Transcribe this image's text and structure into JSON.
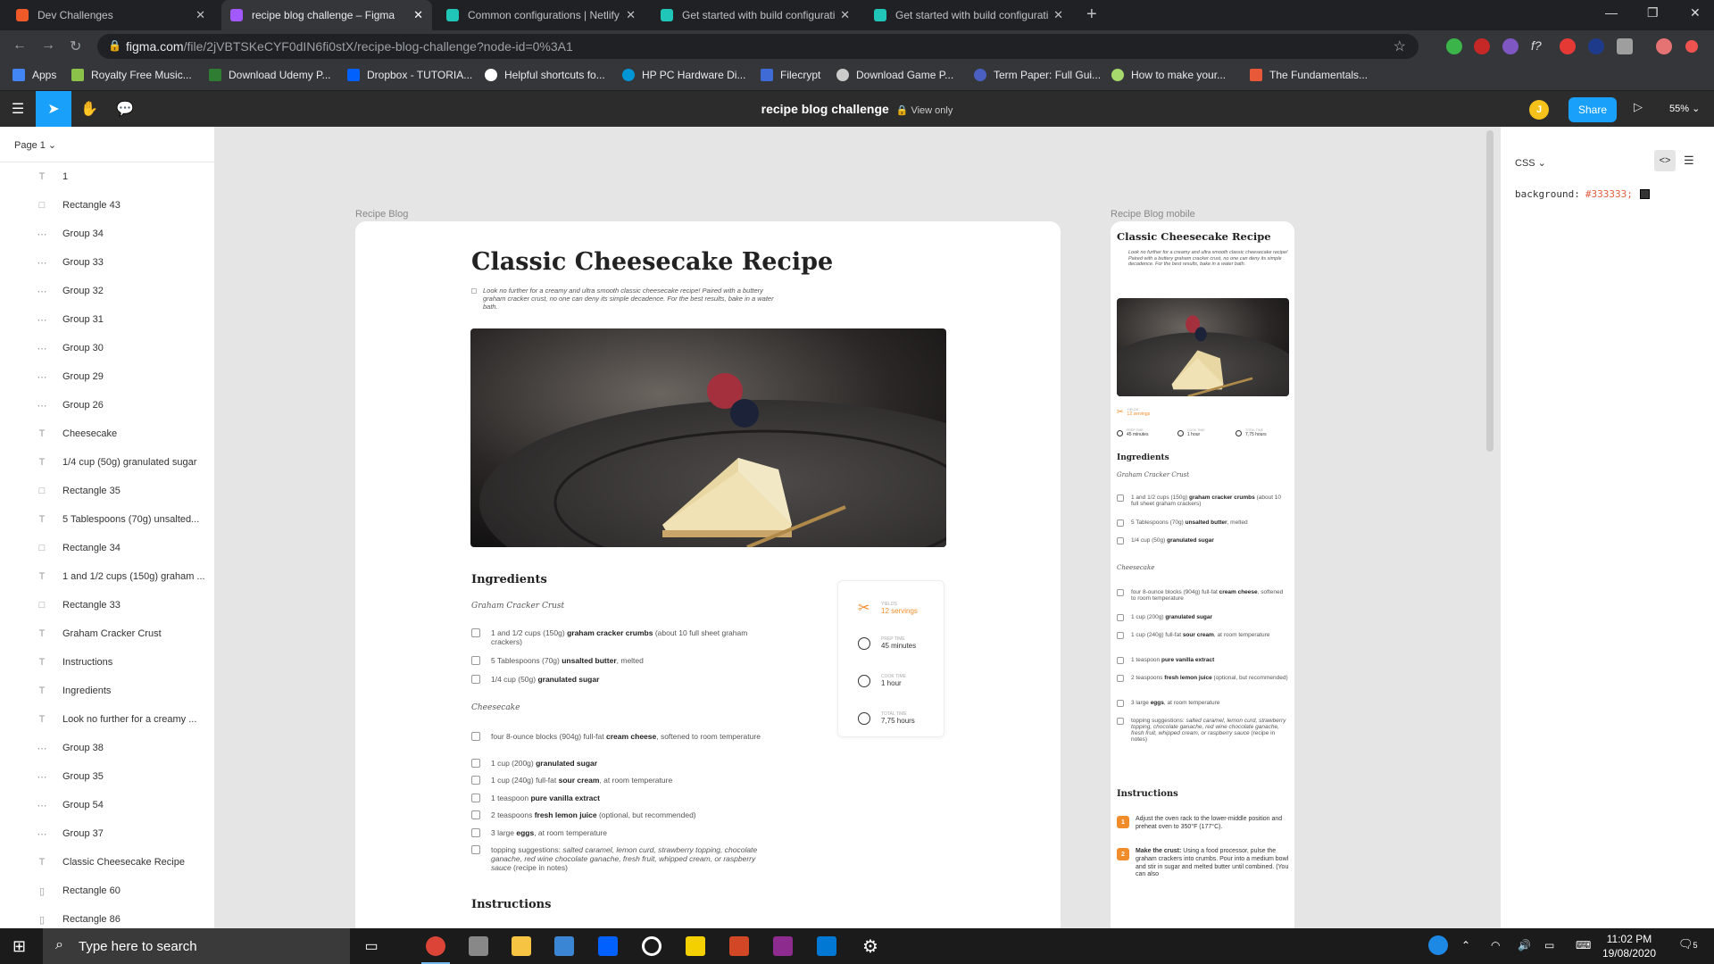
{
  "browser": {
    "tabs": [
      {
        "label": "Dev Challenges",
        "active": false,
        "color": "#f05a28"
      },
      {
        "label": "recipe blog challenge – Figma",
        "active": true,
        "color": "#a259ff"
      },
      {
        "label": "Common configurations | Netlify",
        "active": false,
        "color": "#20c6b7"
      },
      {
        "label": "Get started with build configurati",
        "active": false,
        "color": "#20c6b7"
      },
      {
        "label": "Get started with build configurati",
        "active": false,
        "color": "#20c6b7"
      }
    ],
    "new_tab": "+",
    "url_host": "figma.com",
    "url_path": "/file/2jVBTSKeCYF0dIN6fi0stX/recipe-blog-challenge?node-id=0%3A1",
    "bookmarks": [
      {
        "label": "Apps",
        "color": "#4285f4"
      },
      {
        "label": "Royalty Free Music...",
        "color": "#8bc34a"
      },
      {
        "label": "Download Udemy P...",
        "color": "#2e7d32"
      },
      {
        "label": "Dropbox - TUTORIA...",
        "color": "#0061ff"
      },
      {
        "label": "Helpful shortcuts fo...",
        "color": "#ffffff"
      },
      {
        "label": "HP PC Hardware Di...",
        "color": "#0096d6"
      },
      {
        "label": "Filecrypt",
        "color": "#3f6bd6"
      },
      {
        "label": "Download Game P...",
        "color": "#cccccc"
      },
      {
        "label": "Term Paper: Full Gui...",
        "color": "#4a5fc1"
      },
      {
        "label": "How to make your...",
        "color": "#a6d86e"
      },
      {
        "label": "The Fundamentals...",
        "color": "#e8593a"
      }
    ]
  },
  "figma": {
    "doc_title": "recipe blog challenge",
    "view_only": "View only",
    "avatar_initial": "J",
    "share_label": "Share",
    "zoom": "55%",
    "page_selector": "Page 1",
    "layers": [
      {
        "name": "1",
        "type": "text"
      },
      {
        "name": "Rectangle 43",
        "type": "rect"
      },
      {
        "name": "Group 34",
        "type": "group"
      },
      {
        "name": "Group 33",
        "type": "group"
      },
      {
        "name": "Group 32",
        "type": "group"
      },
      {
        "name": "Group 31",
        "type": "group"
      },
      {
        "name": "Group 30",
        "type": "group"
      },
      {
        "name": "Group 29",
        "type": "group"
      },
      {
        "name": "Group 26",
        "type": "group"
      },
      {
        "name": "Cheesecake",
        "type": "text"
      },
      {
        "name": "1/4 cup (50g) granulated sugar",
        "type": "text"
      },
      {
        "name": "Rectangle 35",
        "type": "rect"
      },
      {
        "name": "5 Tablespoons (70g) unsalted...",
        "type": "text"
      },
      {
        "name": "Rectangle 34",
        "type": "rect"
      },
      {
        "name": "1 and 1/2 cups (150g) graham ...",
        "type": "text"
      },
      {
        "name": "Rectangle 33",
        "type": "rect"
      },
      {
        "name": "Graham Cracker Crust",
        "type": "text"
      },
      {
        "name": "Instructions",
        "type": "text"
      },
      {
        "name": "Ingredients",
        "type": "text"
      },
      {
        "name": "Look no further for a creamy ...",
        "type": "text"
      },
      {
        "name": "Group 38",
        "type": "group"
      },
      {
        "name": "Group 35",
        "type": "group"
      },
      {
        "name": "Group 54",
        "type": "group"
      },
      {
        "name": "Group 37",
        "type": "group"
      },
      {
        "name": "Classic Cheesecake Recipe",
        "type": "text"
      },
      {
        "name": "Rectangle 60",
        "type": "line"
      },
      {
        "name": "Rectangle 86",
        "type": "line"
      }
    ],
    "inspect": {
      "tab": "CSS",
      "property": "background:",
      "value": "#333333;",
      "swatch": "#333333"
    }
  },
  "desktop_frame": {
    "label": "Recipe Blog",
    "title": "Classic Cheesecake Recipe",
    "description": "Look no further for a creamy and ultra smooth classic cheesecake recipe! Paired with a buttery graham cracker crust, no one can deny its simple decadence. For the best results, bake in a water bath.",
    "ingredients_heading": "Ingredients",
    "crust_heading": "Graham Cracker Crust",
    "crust_items": [
      {
        "pre": "1 and 1/2 cups (150g) ",
        "bold": "graham cracker crumbs",
        "post": " (about 10 full sheet graham crackers)"
      },
      {
        "pre": "5 Tablespoons (70g) ",
        "bold": "unsalted butter",
        "post": ", melted"
      },
      {
        "pre": "1/4 cup (50g) ",
        "bold": "granulated sugar",
        "post": ""
      }
    ],
    "cheesecake_heading": "Cheesecake",
    "cheesecake_items": [
      {
        "pre": "four 8-ounce blocks (904g) full-fat ",
        "bold": "cream cheese",
        "post": ", softened to room temperature"
      },
      {
        "pre": "1 cup (200g) ",
        "bold": "granulated sugar",
        "post": ""
      },
      {
        "pre": "1 cup (240g) full-fat ",
        "bold": "sour cream",
        "post": ", at room temperature"
      },
      {
        "pre": "1 teaspoon ",
        "bold": "pure vanilla extract",
        "post": ""
      },
      {
        "pre": "2 teaspoons ",
        "bold": "fresh lemon juice",
        "post": " (optional, but recommended)"
      },
      {
        "pre": "3 large ",
        "bold": "eggs",
        "post": ", at room temperature"
      }
    ],
    "toppings": {
      "pre": "topping suggestions: ",
      "ital": "salted caramel, lemon curd, strawberry topping, chocolate ganache, red wine chocolate ganache, fresh fruit, whipped cream, or raspberry sauce",
      "post": " (recipe in notes)"
    },
    "info": [
      {
        "label": "Yields",
        "value": "12 servings"
      },
      {
        "label": "Prep time",
        "value": "45 minutes"
      },
      {
        "label": "Cook time",
        "value": "1 hour"
      },
      {
        "label": "Total time",
        "value": "7,75 hours"
      }
    ],
    "instructions_heading": "Instructions"
  },
  "mobile_frame": {
    "label": "Recipe Blog mobile",
    "title": "Classic Cheesecake Recipe",
    "description": "Look no further for a creamy and ultra smooth classic cheesecake recipe! Paired with a buttery graham cracker crust, no one can deny its simple decadence. For the best results, bake in a water bath.",
    "yields_label": "Yields",
    "yields_value": "12 servings",
    "times": [
      {
        "label": "Prep time",
        "value": "45 minutes"
      },
      {
        "label": "Cook time",
        "value": "1 hour"
      },
      {
        "label": "Total time",
        "value": "7,75 hours"
      }
    ],
    "ingredients_heading": "Ingredients",
    "crust_heading": "Graham Cracker Crust",
    "cheesecake_heading": "Cheesecake",
    "instructions_heading": "Instructions",
    "steps": [
      {
        "num": "1",
        "bold": "",
        "text": "Adjust the oven rack to the lower-middle position and preheat oven to 350°F (177°C)."
      },
      {
        "num": "2",
        "bold": "Make the crust:",
        "text": " Using a food processor, pulse the graham crackers into crumbs. Pour into a medium bowl and stir in sugar and melted butter until combined. (You can also"
      }
    ]
  },
  "taskbar": {
    "search_placeholder": "Type here to search",
    "time": "11:02 PM",
    "date": "19/08/2020",
    "notifications": "5"
  },
  "colors": {
    "figma_blue": "#18a0fb",
    "accent_orange": "#f08c2a",
    "figma_dark": "#2c2c2c"
  }
}
